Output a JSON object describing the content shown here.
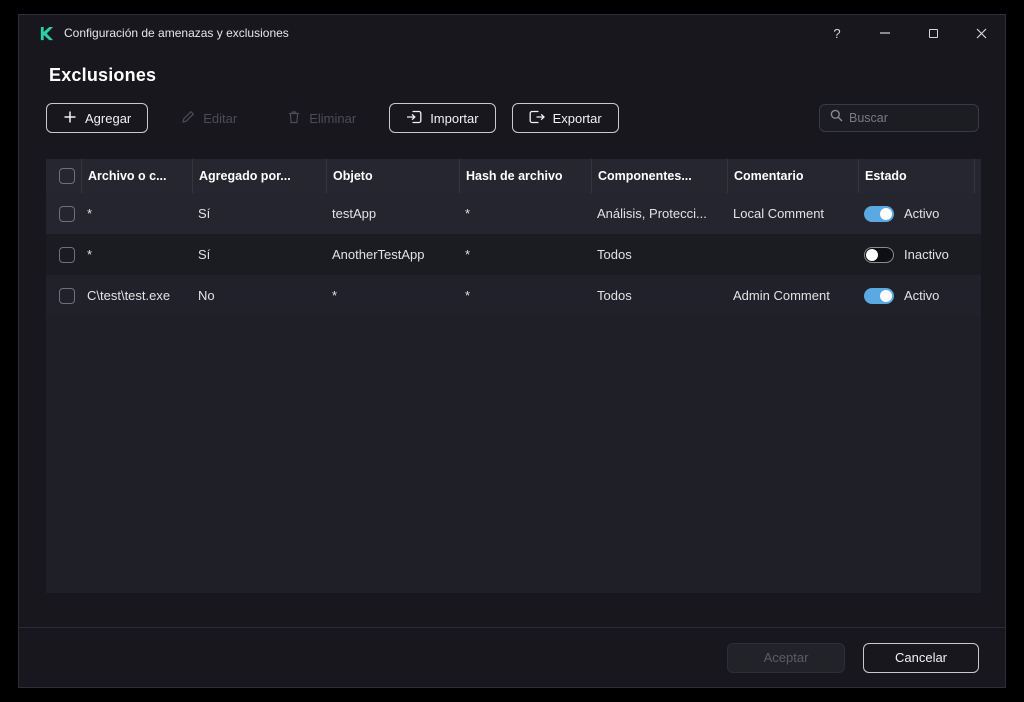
{
  "window": {
    "title": "Configuración de amenazas y exclusiones",
    "controls": {
      "help": "?"
    }
  },
  "page": {
    "title": "Exclusiones"
  },
  "toolbar": {
    "add": "Agregar",
    "edit": "Editar",
    "delete": "Eliminar",
    "import": "Importar",
    "export": "Exportar",
    "search_placeholder": "Buscar"
  },
  "table": {
    "columns": {
      "file": "Archivo o c...",
      "added_by": "Agregado por...",
      "object": "Objeto",
      "hash": "Hash de archivo",
      "components": "Componentes...",
      "comment": "Comentario",
      "state": "Estado"
    },
    "rows": [
      {
        "file": "*",
        "added_by": "Sí",
        "object": "testApp",
        "hash": "*",
        "components": "Análisis, Protecci...",
        "comment": "Local Comment",
        "state_label": "Activo",
        "state": "on"
      },
      {
        "file": "*",
        "added_by": "Sí",
        "object": "AnotherTestApp",
        "hash": "*",
        "components": "Todos",
        "comment": "",
        "state_label": "Inactivo",
        "state": "off"
      },
      {
        "file": "C\\test\\test.exe",
        "added_by": "No",
        "object": "*",
        "hash": "*",
        "components": "Todos",
        "comment": "Admin Comment",
        "state_label": "Activo",
        "state": "on"
      }
    ]
  },
  "footer": {
    "accept": "Aceptar",
    "cancel": "Cancelar"
  },
  "colors": {
    "brand_green": "#2bd0a6",
    "toggle_active": "#5aa9e0",
    "window_bg": "#17171d"
  }
}
